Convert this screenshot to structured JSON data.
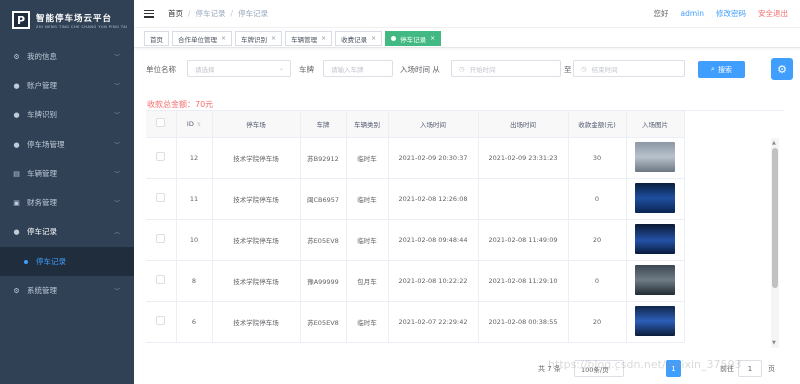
{
  "app": {
    "logo_letter": "P",
    "title": "智能停车场云平台",
    "subtitle": "ZHI NENG TING CHE CHANG YUN PING TAI"
  },
  "sidebar": {
    "items": [
      {
        "label": "我的信息",
        "icon": "gear-icon"
      },
      {
        "label": "账户管理",
        "icon": "user-icon"
      },
      {
        "label": "车牌识别",
        "icon": "user-icon"
      },
      {
        "label": "停车场管理",
        "icon": "user-icon"
      },
      {
        "label": "车辆管理",
        "icon": "card-icon"
      },
      {
        "label": "财务管理",
        "icon": "wallet-icon"
      },
      {
        "label": "停车记录",
        "icon": "user-icon"
      },
      {
        "label": "停车记录",
        "icon": "user-icon"
      },
      {
        "label": "系统管理",
        "icon": "gear-icon"
      }
    ]
  },
  "header": {
    "breadcrumb": [
      "首页",
      "停车记录",
      "停车记录"
    ],
    "hello": "您好",
    "user": "admin",
    "change_password": "修改密码",
    "logout": "安全退出"
  },
  "tags": [
    {
      "label": "首页",
      "closable": false,
      "active": false
    },
    {
      "label": "合作单位管理",
      "closable": true,
      "active": false
    },
    {
      "label": "车牌识别",
      "closable": true,
      "active": false
    },
    {
      "label": "车辆管理",
      "closable": true,
      "active": false
    },
    {
      "label": "收费记录",
      "closable": true,
      "active": false
    },
    {
      "label": "停车记录",
      "closable": true,
      "active": true
    }
  ],
  "filter": {
    "unit_label": "单位名称",
    "unit_placeholder": "请选择",
    "plate_label": "车牌",
    "plate_placeholder": "请输入车牌",
    "time_label": "入场时间 从",
    "start_placeholder": "开始时间",
    "to_label": "至",
    "end_placeholder": "结束时间",
    "search_label": "搜索"
  },
  "summary": {
    "total": "收款总金额：70元"
  },
  "table": {
    "headers": [
      "",
      "ID",
      "停车场",
      "车牌",
      "车辆类别",
      "入场时间",
      "出场时间",
      "收款金额(元)",
      "入场图片"
    ],
    "rows": [
      {
        "id": "12",
        "lot": "技术学院停车场",
        "plate": "苏B92912",
        "type": "临时车",
        "in": "2021-02-09 20:30:37",
        "out": "2021-02-09 23:31:23",
        "amount": "30",
        "photo": "ph-a"
      },
      {
        "id": "11",
        "lot": "技术学院停车场",
        "plate": "闽CB6957",
        "type": "临时车",
        "in": "2021-02-08 12:26:08",
        "out": "",
        "amount": "0",
        "photo": "ph-b"
      },
      {
        "id": "10",
        "lot": "技术学院停车场",
        "plate": "苏E05EV8",
        "type": "临时车",
        "in": "2021-02-08 09:48:44",
        "out": "2021-02-08 11:49:09",
        "amount": "20",
        "photo": "ph-c"
      },
      {
        "id": "8",
        "lot": "技术学院停车场",
        "plate": "豫A99999",
        "type": "包月车",
        "in": "2021-02-08 10:22:22",
        "out": "2021-02-08 11:29:10",
        "amount": "0",
        "photo": "ph-d"
      },
      {
        "id": "6",
        "lot": "技术学院停车场",
        "plate": "苏E05EV8",
        "type": "临时车",
        "in": "2021-02-07 22:29:42",
        "out": "2021-02-08 00:38:55",
        "amount": "20",
        "photo": "ph-e"
      }
    ]
  },
  "pagination": {
    "total": "共 7 条",
    "page_size": "100条/页",
    "current": "1",
    "goto_label": "前往",
    "goto_value": "1",
    "page_suffix": "页"
  },
  "watermark": "https://blog.csdn.net/weixin_37593"
}
